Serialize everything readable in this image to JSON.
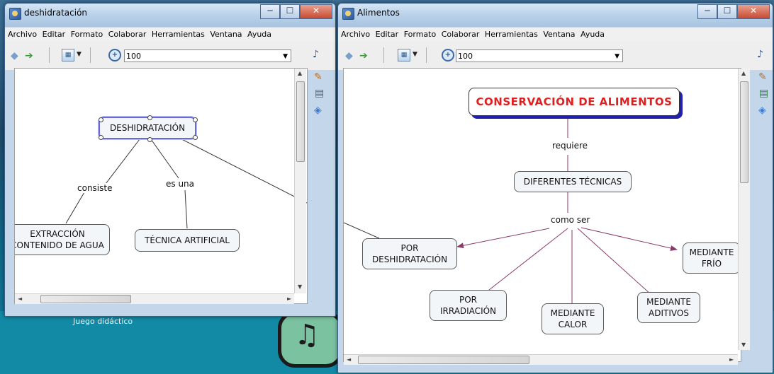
{
  "desktop": {
    "label": "Juego didáctico",
    "music_icon": "music-note-icon"
  },
  "window_left": {
    "title": "deshidratación",
    "menu": [
      "Archivo",
      "Editar",
      "Formato",
      "Colaborar",
      "Herramientas",
      "Ventana",
      "Ayuda"
    ],
    "zoom_value": "100",
    "map": {
      "main": "DESHIDRATACIÓN",
      "link_consiste": "consiste",
      "link_es_una": "es una",
      "node_extraccion": "EXTRACCIÓN\nCONTENIDO DE AGUA",
      "node_tecnica": "TÉCNICA ARTIFICIAL"
    }
  },
  "window_right": {
    "title": "Alimentos",
    "menu": [
      "Archivo",
      "Editar",
      "Formato",
      "Colaborar",
      "Herramientas",
      "Ventana",
      "Ayuda"
    ],
    "zoom_value": "100",
    "map": {
      "main": "CONSERVACIÓN DE ALIMENTOS",
      "link_requiere": "requiere",
      "node_tecnicas": "DIFERENTES TÉCNICAS",
      "link_como_ser": "como ser",
      "node_deshidratacion": "POR\nDESHIDRATACIÓN",
      "node_irradiacion": "POR\nIRRADIACIÓN",
      "node_calor": "MEDIANTE\nCALOR",
      "node_aditivos": "MEDIANTE\nADITIVOS",
      "node_frio": "MEDIANTE\nFRÍO"
    }
  },
  "colors": {
    "main_title_red": "#e02020",
    "main_shadow_blue": "#2020b0",
    "arrow_purple": "#8a3a6a"
  }
}
